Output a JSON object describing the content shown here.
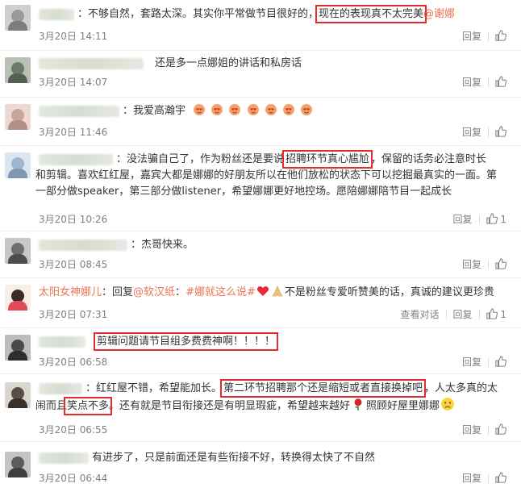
{
  "labels": {
    "reply": "回复",
    "view_thread": "查看对话"
  },
  "comments": [
    {
      "user": "",
      "pre": "：不够自然，套路太深。其实你平常做节目很好的，",
      "hl": "现在的表现真不太完美",
      "mention": "@谢娜",
      "time": "3月20日 14:11",
      "likes": ""
    },
    {
      "user": "",
      "text": "还是多一点娜姐的讲话和私房话",
      "time": "3月20日 14:07",
      "likes": ""
    },
    {
      "user": "",
      "text": "：我爱高瀚宇",
      "time": "3月20日 11:46",
      "likes": ""
    },
    {
      "user": "",
      "pre": "：没法骗自己了，作为粉丝还是要说",
      "hl": "招聘环节真心尴尬",
      "post": "，保留的话务必注意时长",
      "line2": "和剪辑。喜欢红红屋，嘉宾大都是娜娜的好朋友所以在他们放松的状态下可以挖掘最真实的一面。第",
      "line3": "一部分做speaker，第三部分做listener，希望娜娜更好地控场。愿陪娜娜陪节目一起成长",
      "time": "3月20日 10:26",
      "likes": "1"
    },
    {
      "user": "",
      "text": "：杰哥快来。",
      "time": "3月20日 08:45",
      "likes": ""
    },
    {
      "user": "太阳女神娜儿",
      "pre": "：回复",
      "mention": "@软汉纸",
      "mid": "：",
      "tag": "#娜就这么说#",
      "post": "不是粉丝专爱听赞美的话，真诚的建议更珍贵",
      "time": "3月20日 07:31",
      "likes": "1"
    },
    {
      "user": "",
      "hl": "剪辑问题请节目组多费费神啊！！！！",
      "time": "3月20日 06:58",
      "likes": ""
    },
    {
      "user": "",
      "pre": "：红红屋不错，希望能加长。",
      "hl": "第二环节招聘那个还是缩短或者直接换掉吧",
      "post": "，人太多真的太",
      "l2pre": "闹而且",
      "l2hl": "笑点不多",
      "l2post": "。还有就是节目衔接还是有明显瑕疵，希望越来越好",
      "l2post2": "照顾好屋里娜娜",
      "time": "3月20日 06:55",
      "likes": ""
    },
    {
      "user": "",
      "text": "有进步了，只是前面还是有些衔接不好，转换得太快了不自然",
      "time": "3月20日 06:44",
      "likes": ""
    }
  ],
  "colors": {
    "link": "#eb7350",
    "highlight_box": "#e52b2b",
    "meta": "#808080"
  }
}
